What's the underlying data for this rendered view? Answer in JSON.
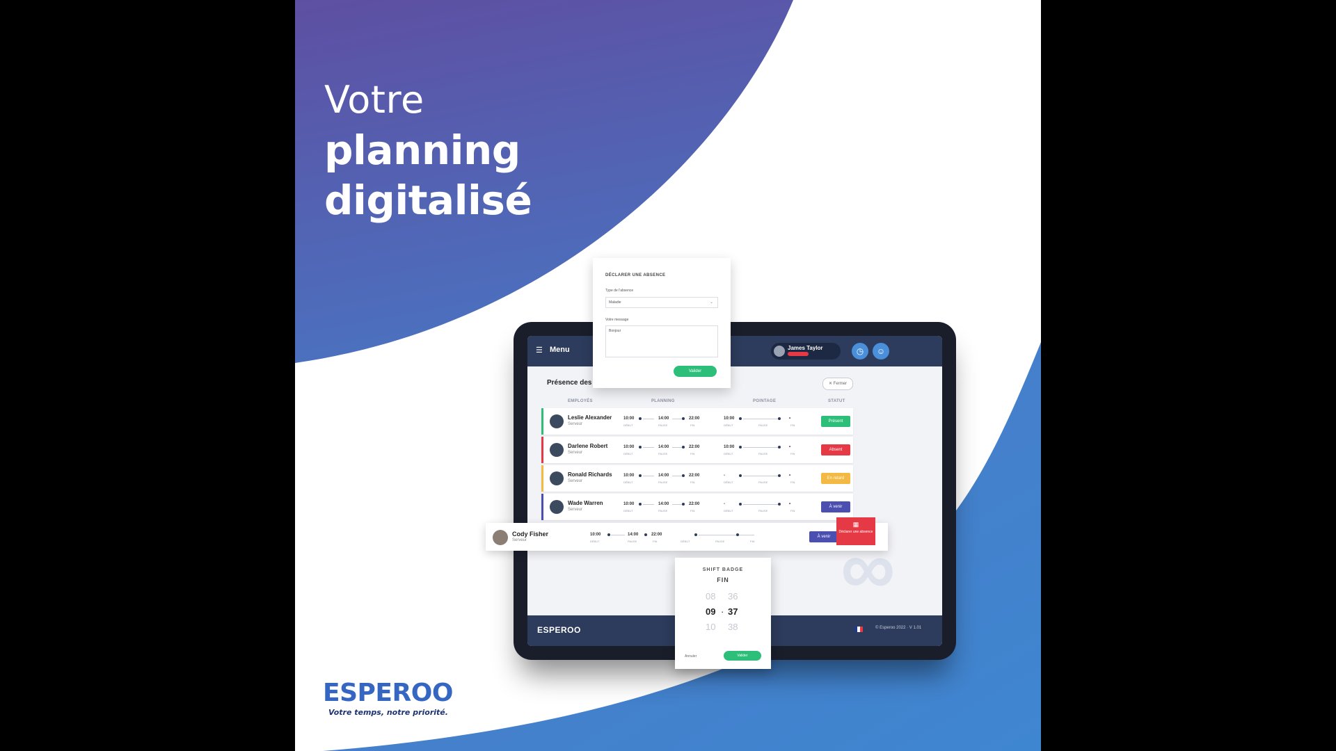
{
  "headline": {
    "line1": "Votre",
    "line2": "planning",
    "line3": "digitalisé"
  },
  "colors": {
    "purple": "#5e4fa2",
    "blue": "#4a7fc6",
    "green": "#2dbf7a",
    "red": "#e63946",
    "orange": "#f4b942",
    "navy": "#2d3b5c"
  },
  "app": {
    "menu_label": "Menu",
    "user_name": "James Taylor",
    "page_title": "Présence des",
    "close_label": "Fermer",
    "columns": [
      "EMPLOYÉS",
      "PLANNING",
      "POINTAGE",
      "STATUT"
    ],
    "rows": [
      {
        "name": "Leslie Alexander",
        "role": "Serveur",
        "start": "10:00",
        "pause": "14:00",
        "end": "22:00",
        "real_start": "10:00",
        "status": "Présent"
      },
      {
        "name": "Darlene Robert",
        "role": "Serveur",
        "start": "10:00",
        "pause": "14:00",
        "end": "22:00",
        "real_start": "10:00",
        "status": "Absent"
      },
      {
        "name": "Ronald Richards",
        "role": "Serveur",
        "start": "10:00",
        "pause": "14:00",
        "end": "22:00",
        "real_start": "-",
        "status": "En retard"
      },
      {
        "name": "Wade Warren",
        "role": "Serveur",
        "start": "10:00",
        "pause": "14:00",
        "end": "22:00",
        "real_start": "-",
        "status": "À venir"
      }
    ],
    "timeline_labels": {
      "start": "DÉBUT",
      "pause": "PAUSE",
      "end": "FIN"
    },
    "footer_logo": "ESPEROO",
    "footer_copy": "© Esperoo 2022 · V 1.01"
  },
  "absence_dialog": {
    "title": "DÉCLARER UNE ABSENCE",
    "type_label": "Type de l'absence",
    "type_value": "Maladie",
    "message_label": "Votre message",
    "message_value": "Bonjour",
    "send_label": "Valider"
  },
  "highlight_row": {
    "name": "Cody Fisher",
    "role": "Serveur",
    "start": "10:00",
    "pause": "14:00",
    "end": "22:00",
    "go_label": "À venir",
    "declare_label": "Déclarer une absence"
  },
  "time_picker": {
    "title": "SHIFT BADGE",
    "subtitle": "FIN",
    "hours": [
      "08",
      "09",
      "10"
    ],
    "minutes": [
      "36",
      "37",
      "38"
    ],
    "cancel": "Annuler",
    "confirm": "Valider"
  },
  "brand": {
    "logo": "ESPEROO",
    "tagline": "Votre temps, notre priorité."
  }
}
